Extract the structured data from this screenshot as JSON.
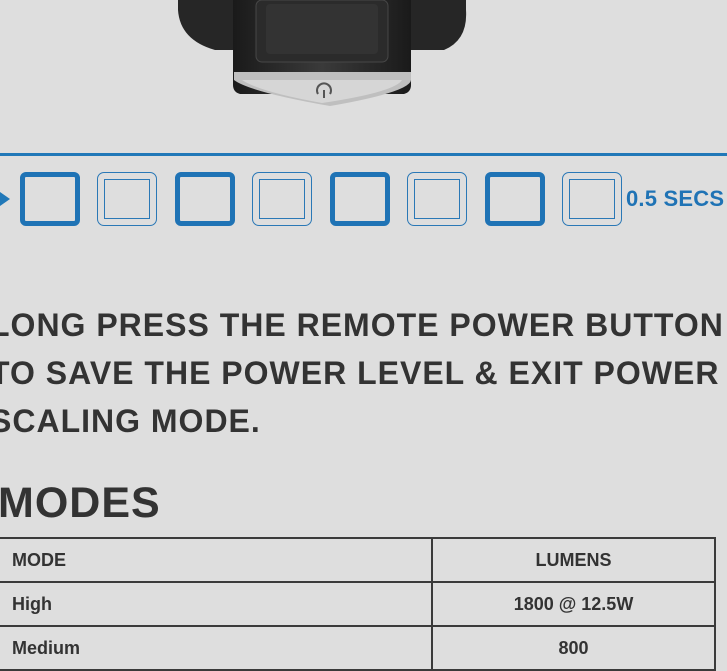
{
  "instructions": {
    "line1": "LONG PRESS THE REMOTE POWER BUTTON",
    "line2": "TO SAVE THE POWER LEVEL & EXIT POWER",
    "line3": "SCALING MODE."
  },
  "timing": {
    "label": "0.5 SECS",
    "pattern": [
      "on",
      "off",
      "on",
      "off",
      "on",
      "off",
      "on",
      "off"
    ]
  },
  "modes": {
    "title": "MODES",
    "headers": [
      "MODE",
      "LUMENS"
    ],
    "rows": [
      [
        "High",
        "1800 @ 12.5W"
      ],
      [
        "Medium",
        "800"
      ]
    ]
  },
  "colors": {
    "accent": "#1f73b5",
    "text": "#333333",
    "background": "#dedede"
  }
}
